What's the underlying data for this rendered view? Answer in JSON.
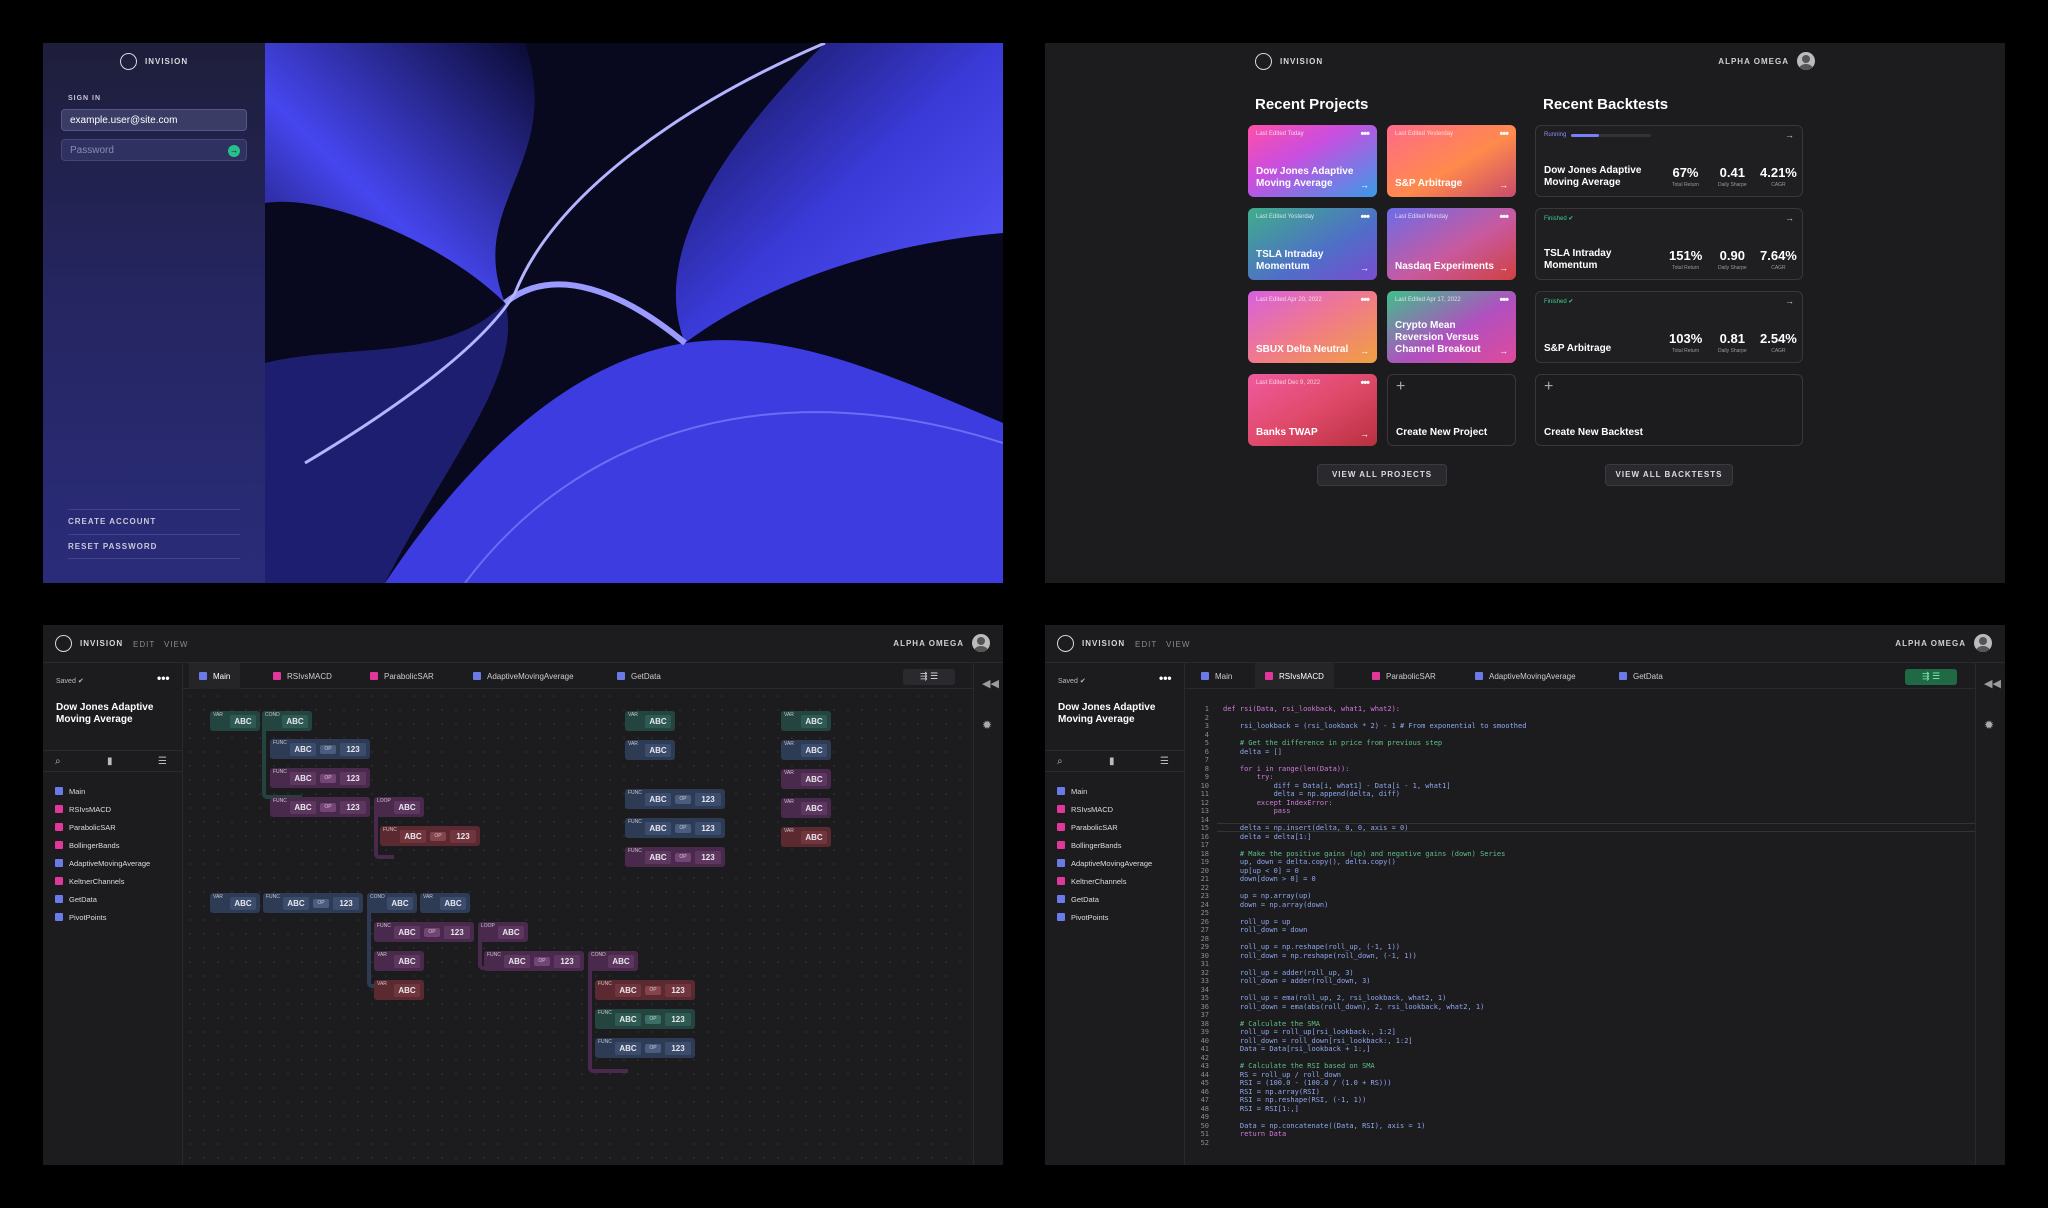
{
  "brand": "INVISION",
  "login": {
    "heading": "SIGN IN",
    "email_value": "example.user@site.com",
    "password_placeholder": "Password",
    "create_account": "CREATE ACCOUNT",
    "reset_password": "RESET PASSWORD"
  },
  "dashboard": {
    "user": "ALPHA OMEGA",
    "projects_heading": "Recent Projects",
    "backtests_heading": "Recent Backtests",
    "projects": [
      {
        "date": "Last Edited Today",
        "title": "Dow Jones Adaptive Moving Average"
      },
      {
        "date": "Last Edited Yesterday",
        "title": "S&P Arbitrage"
      },
      {
        "date": "Last Edited Yesterday",
        "title": "TSLA Intraday Momentum"
      },
      {
        "date": "Last Edited Monday",
        "title": "Nasdaq Experiments"
      },
      {
        "date": "Last Edited Apr 20, 2022",
        "title": "SBUX Delta Neutral"
      },
      {
        "date": "Last Edited Apr 17, 2022",
        "title": "Crypto Mean Reversion Versus Channel Breakout"
      },
      {
        "date": "Last Edited Dec 9, 2022",
        "title": "Banks TWAP"
      }
    ],
    "create_project": "Create New Project",
    "backtests": [
      {
        "status": "Running",
        "title": "Dow Jones Adaptive Moving Average",
        "total_return": "67%",
        "daily_sharpe": "0.41",
        "cagr": "4.21%"
      },
      {
        "status": "Finished",
        "title": "TSLA Intraday Momentum",
        "total_return": "151%",
        "daily_sharpe": "0.90",
        "cagr": "7.64%"
      },
      {
        "status": "Finished",
        "title": "S&P Arbitrage",
        "total_return": "103%",
        "daily_sharpe": "0.81",
        "cagr": "2.54%"
      }
    ],
    "stat_labels": {
      "total_return": "Total Return",
      "daily_sharpe": "Daily Sharpe",
      "cagr": "CAGR"
    },
    "create_backtest": "Create New Backtest",
    "view_all_projects": "VIEW ALL PROJECTS",
    "view_all_backtests": "VIEW ALL BACKTESTS",
    "running_progress": 0.35
  },
  "editor": {
    "menu": {
      "edit": "EDIT",
      "view": "VIEW"
    },
    "user": "ALPHA OMEGA",
    "saved": "Saved",
    "project_title": "Dow Jones Adaptive Moving Average",
    "files": [
      {
        "name": "Main",
        "icon": "blue-doc-icon",
        "color": "#6a7be8"
      },
      {
        "name": "RSIvsMACD",
        "icon": "pink-square-icon",
        "color": "#e0379a"
      },
      {
        "name": "ParabolicSAR",
        "icon": "pink-square-icon",
        "color": "#e0379a"
      },
      {
        "name": "BollingerBands",
        "icon": "pink-square-icon",
        "color": "#e0379a"
      },
      {
        "name": "AdaptiveMovingAverage",
        "icon": "blue-doc-icon",
        "color": "#6a7be8"
      },
      {
        "name": "KeltnerChannels",
        "icon": "pink-square-icon",
        "color": "#e0379a"
      },
      {
        "name": "GetData",
        "icon": "blue-doc-icon",
        "color": "#6a7be8"
      },
      {
        "name": "PivotPoints",
        "icon": "blue-doc-icon",
        "color": "#6a7be8"
      }
    ],
    "tabs": [
      "Main",
      "RSIvsMACD",
      "ParabolicSAR",
      "AdaptiveMovingAverage",
      "GetData"
    ],
    "block_text": {
      "var": "VAR",
      "func": "FUNC",
      "cond": "COND",
      "loop": "LOOP",
      "abc": "ABC",
      "op": "OP",
      "num": "123"
    }
  },
  "code_lines": [
    "def rsi(Data, rsi_lookback, what1, what2):",
    "",
    "    rsi_lookback = (rsi_lookback * 2) - 1 # From exponential to smoothed",
    "",
    "    # Get the difference in price from previous step",
    "    delta = []",
    "",
    "    for i in range(len(Data)):",
    "        try:",
    "            diff = Data[i, what1] - Data[i - 1, what1]",
    "            delta = np.append(delta, diff)",
    "        except IndexError:",
    "            pass",
    "",
    "    delta = np.insert(delta, 0, 0, axis = 0)",
    "    delta = delta[1:]",
    "",
    "    # Make the positive gains (up) and negative gains (down) Series",
    "    up, down = delta.copy(), delta.copy()",
    "    up[up < 0] = 0",
    "    down[down > 0] = 0",
    "",
    "    up = np.array(up)",
    "    down = np.array(down)",
    "",
    "    roll_up = up",
    "    roll_down = down",
    "",
    "    roll_up = np.reshape(roll_up, (-1, 1))",
    "    roll_down = np.reshape(roll_down, (-1, 1))",
    "",
    "    roll_up = adder(roll_up, 3)",
    "    roll_down = adder(roll_down, 3)",
    "",
    "    roll_up = ema(roll_up, 2, rsi_lookback, what2, 1)",
    "    roll_down = ema(abs(roll_down), 2, rsi_lookback, what2, 1)",
    "",
    "    # Calculate the SMA",
    "    roll_up = roll_up[rsi_lookback:, 1:2]",
    "    roll_down = roll_down[rsi_lookback:, 1:2]",
    "    Data = Data[rsi_lookback + 1:,]",
    "",
    "    # Calculate the RSI based on SMA",
    "    RS = roll_up / roll_down",
    "    RSI = (100.0 - (100.0 / (1.0 + RS)))",
    "    RSI = np.array(RSI)",
    "    RSI = np.reshape(RSI, (-1, 1))",
    "    RSI = RSI[1:,]",
    "",
    "    Data = np.concatenate((Data, RSI), axis = 1)",
    "    return Data",
    ""
  ]
}
